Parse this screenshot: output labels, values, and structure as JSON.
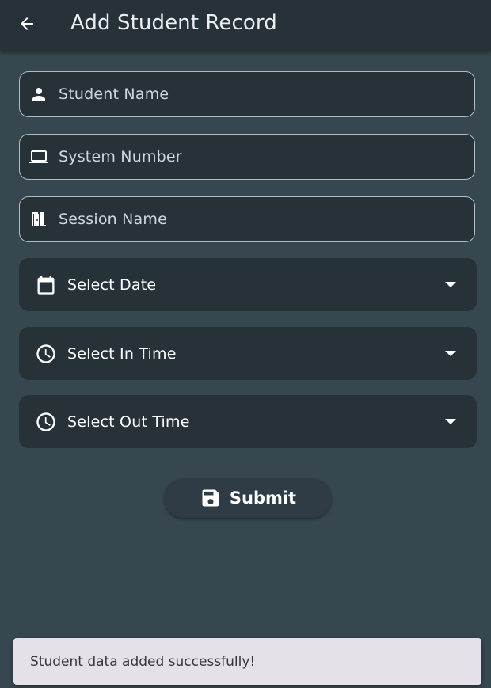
{
  "app_bar": {
    "title": "Add Student Record",
    "back_icon": "arrow-back-icon"
  },
  "form": {
    "student_name": {
      "placeholder": "Student Name",
      "value": "",
      "icon": "person-icon"
    },
    "system_number": {
      "placeholder": "System Number",
      "value": "",
      "icon": "laptop-icon"
    },
    "session_name": {
      "placeholder": "Session Name",
      "value": "",
      "icon": "door-icon"
    }
  },
  "pickers": {
    "date": {
      "label": "Select Date",
      "icon": "calendar-icon"
    },
    "in_time": {
      "label": "Select In Time",
      "icon": "clock-icon"
    },
    "out_time": {
      "label": "Select Out Time",
      "icon": "clock-icon"
    }
  },
  "submit": {
    "label": "Submit",
    "icon": "save-icon"
  },
  "snackbar": {
    "message": "Student data added successfully!"
  },
  "colors": {
    "background": "#37474f",
    "app_bar": "#263238",
    "field_fill": "#263238",
    "field_border": "#b0bec5",
    "snackbar": "#e6e1e8"
  }
}
